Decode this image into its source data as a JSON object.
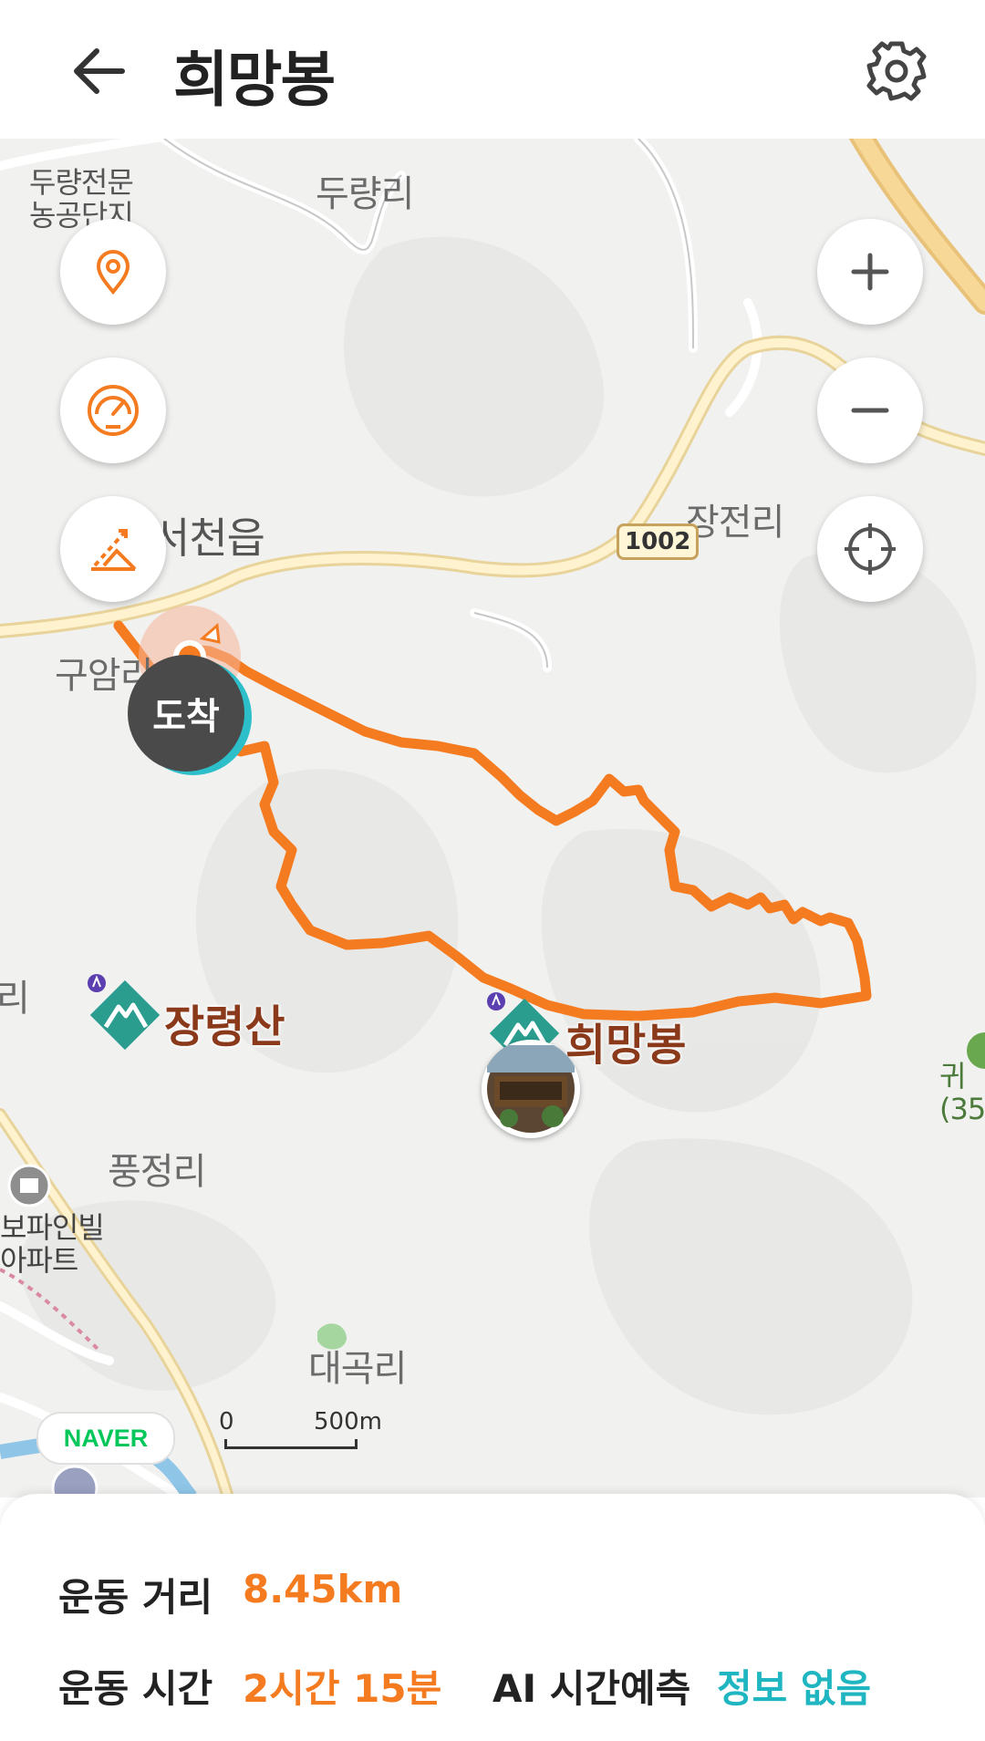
{
  "header": {
    "title": "희망봉",
    "back_icon": "arrow-left-icon",
    "settings_icon": "gear-icon"
  },
  "map": {
    "place_labels": [
      "두량전문\n농공단지",
      "두량리",
      "장전리",
      "구암리",
      "풍정리",
      "대곡리",
      "리",
      "귀\n(35"
    ],
    "town_label": "서천읍",
    "apartment_label": "보파인빌\n아파트",
    "road_number": "1002",
    "peaks": [
      "장령산",
      "희망봉"
    ],
    "arrival_label": "도착",
    "attribution": "NAVER",
    "scale": {
      "start": "0",
      "end": "500m"
    },
    "colors": {
      "route": "#f47b20",
      "accent_teal": "#2cbfc9",
      "peak_icon": "#2a9d8f"
    }
  },
  "controls": {
    "left": [
      "location-pin-icon",
      "speedometer-icon",
      "altitude-icon"
    ],
    "right": [
      "zoom-in-icon",
      "zoom-out-icon",
      "crosshair-icon"
    ]
  },
  "stats": {
    "distance_label": "운동 거리",
    "distance_value": "8.45km",
    "time_label": "운동 시간",
    "time_value": "2시간 15분",
    "ai_label": "AI 시간예측",
    "ai_value": "정보 없음"
  }
}
